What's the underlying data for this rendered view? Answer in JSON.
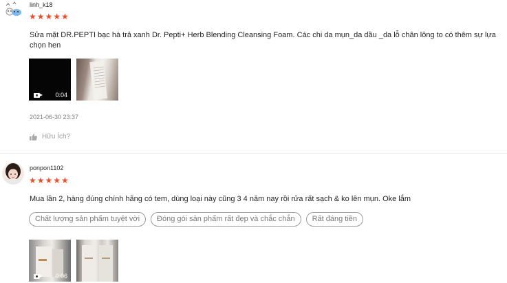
{
  "reviews": [
    {
      "username": "linh_k18",
      "stars": "★★★★★",
      "rating": 5,
      "content": "Sửa mặt DR.PEPTI bạc hà trả xanh Dr. Pepti+ Herb Blending Cleansing Foam. Các chi da mụn_da dầu _da lỗ chân lông to có thêm sự lựa chọn hen",
      "media": [
        {
          "type": "video",
          "duration": "0:04",
          "icon": "video-camera-icon"
        },
        {
          "type": "image",
          "description_icon": "product-photo"
        }
      ],
      "date": "2021-06-30 23:37",
      "helpful_label": "Hữu Ích?",
      "helpful_icon": "thumbs-up-icon"
    },
    {
      "username": "ponpon1102",
      "stars": "★★★★★",
      "rating": 5,
      "content": "Mua lần 2, hàng đúng chính hãng có tem, dùng loại này cũng 3 4 năm nay rồi rửa rất sạch & ko lên mụn. Oke lắm",
      "tags": [
        "Chất lượng sản phẩm tuyệt vời",
        "Đóng gói sản phẩm rất đẹp và chắc chắn",
        "Rất đáng tiền"
      ],
      "media": [
        {
          "type": "video",
          "duration": "0:06",
          "icon": "video-camera-icon"
        },
        {
          "type": "image",
          "description_icon": "product-photo"
        }
      ]
    }
  ],
  "colors": {
    "star": "#ee4d2d",
    "text": "#222222",
    "muted": "#757575",
    "divider": "#e8e8e8"
  }
}
